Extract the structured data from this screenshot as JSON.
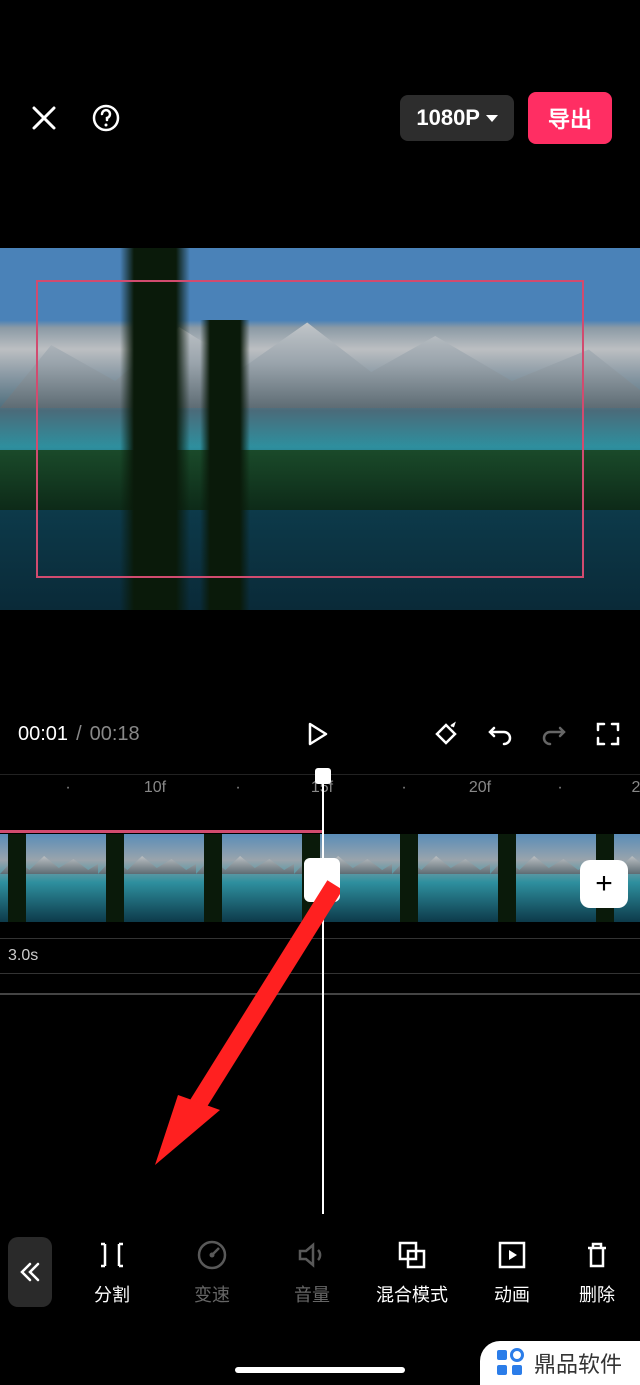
{
  "header": {
    "resolution_label": "1080P",
    "export_label": "导出"
  },
  "controls": {
    "time_current": "00:01",
    "time_separator": "/",
    "time_total": "00:18"
  },
  "ruler": {
    "ticks": [
      "10f",
      "15f",
      "20f",
      "2"
    ]
  },
  "timeline": {
    "track2_duration": "3.0s",
    "add_label": "+"
  },
  "toolbar": {
    "items": [
      {
        "label": "分割",
        "icon": "split-icon",
        "dim": false
      },
      {
        "label": "变速",
        "icon": "speed-icon",
        "dim": true
      },
      {
        "label": "音量",
        "icon": "volume-icon",
        "dim": true
      },
      {
        "label": "混合模式",
        "icon": "blend-icon",
        "dim": false
      },
      {
        "label": "动画",
        "icon": "animation-icon",
        "dim": false
      },
      {
        "label": "删除",
        "icon": "delete-icon",
        "dim": false
      }
    ]
  },
  "watermark": {
    "text": "鼎品软件"
  }
}
